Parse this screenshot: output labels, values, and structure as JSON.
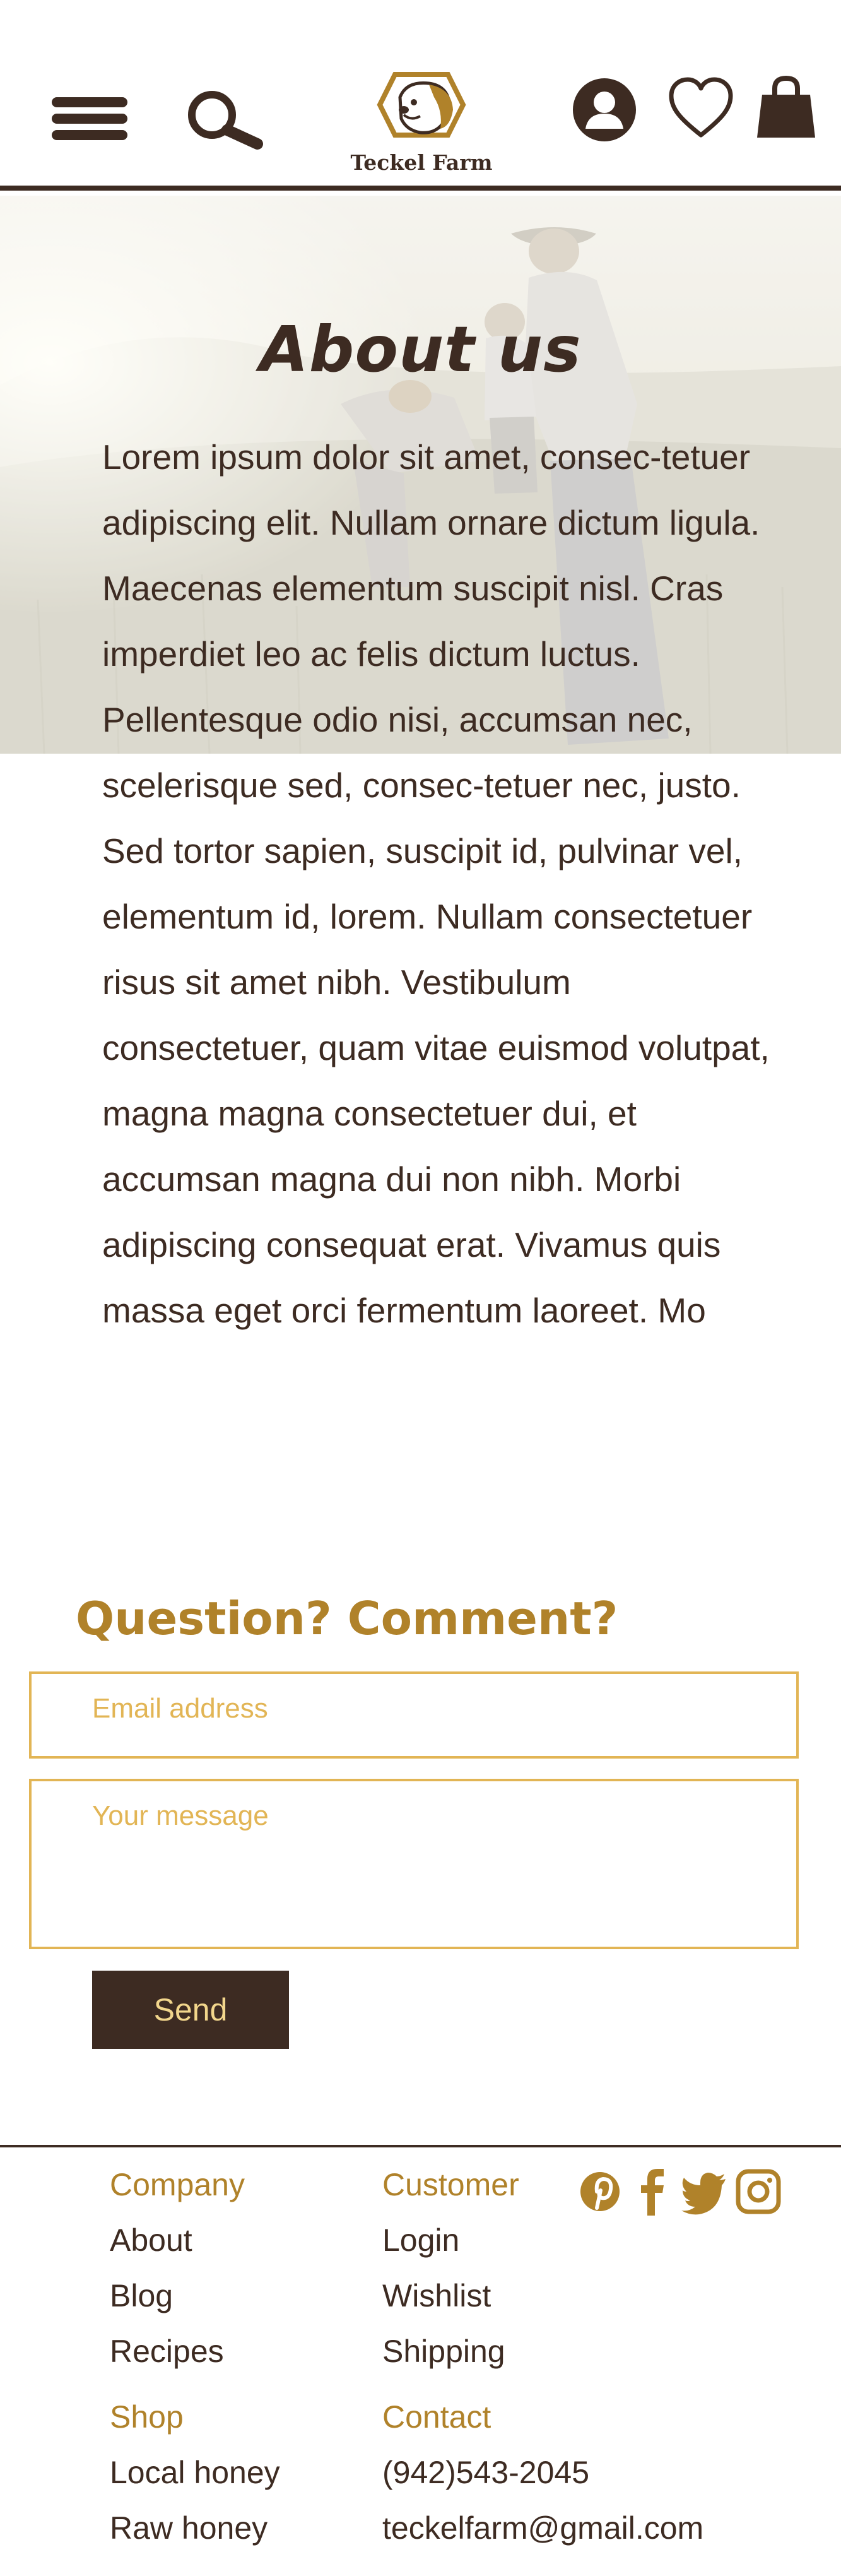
{
  "header": {
    "brand": "Teckel Farm",
    "icons": [
      "menu-icon",
      "search-icon",
      "logo-dog-icon",
      "account-icon",
      "heart-icon",
      "shopping-bag-icon"
    ]
  },
  "about": {
    "title": "About us",
    "body": "Lorem ipsum dolor sit amet, consec-tetuer adipiscing elit. Nullam ornare dictum ligula. Maecenas elementum suscipit nisl. Cras imperdiet leo ac felis dictum luctus. Pellentesque odio nisi, accumsan nec, scelerisque sed, consec-tetuer nec, justo. Sed tortor sapien, suscipit id, pulvinar vel, elementum id, lorem. Nullam consectetuer risus sit amet nibh. Vestibulum consectetuer, quam vitae euismod volutpat, magna magna consectetuer dui, et accumsan magna dui non nibh. Morbi adipiscing consequat erat. Vivamus quis massa eget orci fermentum laoreet. Mo"
  },
  "contact_form": {
    "title": "Question? Comment?",
    "email_placeholder": "Email address",
    "message_placeholder": "Your message",
    "send_label": "Send"
  },
  "footer": {
    "company": {
      "heading": "Company",
      "links": [
        "About",
        "Blog",
        "Recipes"
      ]
    },
    "customer": {
      "heading": "Customer",
      "links": [
        "Login",
        "Wishlist",
        "Shipping"
      ]
    },
    "shop": {
      "heading": "Shop",
      "links": [
        "Local honey",
        "Raw honey"
      ]
    },
    "contact": {
      "heading": "Contact",
      "phone": "(942)543-2045",
      "email": "teckelfarm@gmail.com"
    },
    "social_icons": [
      "pinterest-icon",
      "facebook-icon",
      "twitter-icon",
      "instagram-icon"
    ]
  },
  "colors": {
    "brown": "#3d2b22",
    "gold": "#b0822a",
    "light_gold": "#e2b555",
    "button_text": "#f2d68c"
  }
}
